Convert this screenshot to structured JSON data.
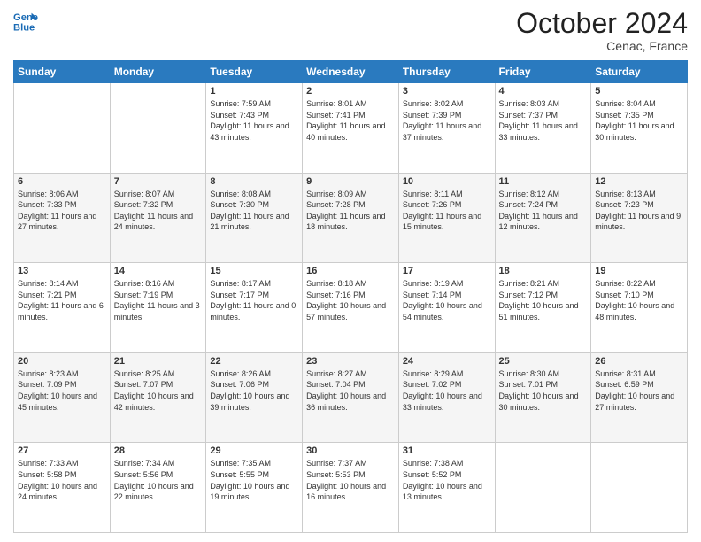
{
  "header": {
    "logo_line1": "General",
    "logo_line2": "Blue",
    "month": "October 2024",
    "location": "Cenac, France"
  },
  "days_of_week": [
    "Sunday",
    "Monday",
    "Tuesday",
    "Wednesday",
    "Thursday",
    "Friday",
    "Saturday"
  ],
  "weeks": [
    [
      {
        "day": "",
        "sunrise": "",
        "sunset": "",
        "daylight": ""
      },
      {
        "day": "",
        "sunrise": "",
        "sunset": "",
        "daylight": ""
      },
      {
        "day": "1",
        "sunrise": "Sunrise: 7:59 AM",
        "sunset": "Sunset: 7:43 PM",
        "daylight": "Daylight: 11 hours and 43 minutes."
      },
      {
        "day": "2",
        "sunrise": "Sunrise: 8:01 AM",
        "sunset": "Sunset: 7:41 PM",
        "daylight": "Daylight: 11 hours and 40 minutes."
      },
      {
        "day": "3",
        "sunrise": "Sunrise: 8:02 AM",
        "sunset": "Sunset: 7:39 PM",
        "daylight": "Daylight: 11 hours and 37 minutes."
      },
      {
        "day": "4",
        "sunrise": "Sunrise: 8:03 AM",
        "sunset": "Sunset: 7:37 PM",
        "daylight": "Daylight: 11 hours and 33 minutes."
      },
      {
        "day": "5",
        "sunrise": "Sunrise: 8:04 AM",
        "sunset": "Sunset: 7:35 PM",
        "daylight": "Daylight: 11 hours and 30 minutes."
      }
    ],
    [
      {
        "day": "6",
        "sunrise": "Sunrise: 8:06 AM",
        "sunset": "Sunset: 7:33 PM",
        "daylight": "Daylight: 11 hours and 27 minutes."
      },
      {
        "day": "7",
        "sunrise": "Sunrise: 8:07 AM",
        "sunset": "Sunset: 7:32 PM",
        "daylight": "Daylight: 11 hours and 24 minutes."
      },
      {
        "day": "8",
        "sunrise": "Sunrise: 8:08 AM",
        "sunset": "Sunset: 7:30 PM",
        "daylight": "Daylight: 11 hours and 21 minutes."
      },
      {
        "day": "9",
        "sunrise": "Sunrise: 8:09 AM",
        "sunset": "Sunset: 7:28 PM",
        "daylight": "Daylight: 11 hours and 18 minutes."
      },
      {
        "day": "10",
        "sunrise": "Sunrise: 8:11 AM",
        "sunset": "Sunset: 7:26 PM",
        "daylight": "Daylight: 11 hours and 15 minutes."
      },
      {
        "day": "11",
        "sunrise": "Sunrise: 8:12 AM",
        "sunset": "Sunset: 7:24 PM",
        "daylight": "Daylight: 11 hours and 12 minutes."
      },
      {
        "day": "12",
        "sunrise": "Sunrise: 8:13 AM",
        "sunset": "Sunset: 7:23 PM",
        "daylight": "Daylight: 11 hours and 9 minutes."
      }
    ],
    [
      {
        "day": "13",
        "sunrise": "Sunrise: 8:14 AM",
        "sunset": "Sunset: 7:21 PM",
        "daylight": "Daylight: 11 hours and 6 minutes."
      },
      {
        "day": "14",
        "sunrise": "Sunrise: 8:16 AM",
        "sunset": "Sunset: 7:19 PM",
        "daylight": "Daylight: 11 hours and 3 minutes."
      },
      {
        "day": "15",
        "sunrise": "Sunrise: 8:17 AM",
        "sunset": "Sunset: 7:17 PM",
        "daylight": "Daylight: 11 hours and 0 minutes."
      },
      {
        "day": "16",
        "sunrise": "Sunrise: 8:18 AM",
        "sunset": "Sunset: 7:16 PM",
        "daylight": "Daylight: 10 hours and 57 minutes."
      },
      {
        "day": "17",
        "sunrise": "Sunrise: 8:19 AM",
        "sunset": "Sunset: 7:14 PM",
        "daylight": "Daylight: 10 hours and 54 minutes."
      },
      {
        "day": "18",
        "sunrise": "Sunrise: 8:21 AM",
        "sunset": "Sunset: 7:12 PM",
        "daylight": "Daylight: 10 hours and 51 minutes."
      },
      {
        "day": "19",
        "sunrise": "Sunrise: 8:22 AM",
        "sunset": "Sunset: 7:10 PM",
        "daylight": "Daylight: 10 hours and 48 minutes."
      }
    ],
    [
      {
        "day": "20",
        "sunrise": "Sunrise: 8:23 AM",
        "sunset": "Sunset: 7:09 PM",
        "daylight": "Daylight: 10 hours and 45 minutes."
      },
      {
        "day": "21",
        "sunrise": "Sunrise: 8:25 AM",
        "sunset": "Sunset: 7:07 PM",
        "daylight": "Daylight: 10 hours and 42 minutes."
      },
      {
        "day": "22",
        "sunrise": "Sunrise: 8:26 AM",
        "sunset": "Sunset: 7:06 PM",
        "daylight": "Daylight: 10 hours and 39 minutes."
      },
      {
        "day": "23",
        "sunrise": "Sunrise: 8:27 AM",
        "sunset": "Sunset: 7:04 PM",
        "daylight": "Daylight: 10 hours and 36 minutes."
      },
      {
        "day": "24",
        "sunrise": "Sunrise: 8:29 AM",
        "sunset": "Sunset: 7:02 PM",
        "daylight": "Daylight: 10 hours and 33 minutes."
      },
      {
        "day": "25",
        "sunrise": "Sunrise: 8:30 AM",
        "sunset": "Sunset: 7:01 PM",
        "daylight": "Daylight: 10 hours and 30 minutes."
      },
      {
        "day": "26",
        "sunrise": "Sunrise: 8:31 AM",
        "sunset": "Sunset: 6:59 PM",
        "daylight": "Daylight: 10 hours and 27 minutes."
      }
    ],
    [
      {
        "day": "27",
        "sunrise": "Sunrise: 7:33 AM",
        "sunset": "Sunset: 5:58 PM",
        "daylight": "Daylight: 10 hours and 24 minutes."
      },
      {
        "day": "28",
        "sunrise": "Sunrise: 7:34 AM",
        "sunset": "Sunset: 5:56 PM",
        "daylight": "Daylight: 10 hours and 22 minutes."
      },
      {
        "day": "29",
        "sunrise": "Sunrise: 7:35 AM",
        "sunset": "Sunset: 5:55 PM",
        "daylight": "Daylight: 10 hours and 19 minutes."
      },
      {
        "day": "30",
        "sunrise": "Sunrise: 7:37 AM",
        "sunset": "Sunset: 5:53 PM",
        "daylight": "Daylight: 10 hours and 16 minutes."
      },
      {
        "day": "31",
        "sunrise": "Sunrise: 7:38 AM",
        "sunset": "Sunset: 5:52 PM",
        "daylight": "Daylight: 10 hours and 13 minutes."
      },
      {
        "day": "",
        "sunrise": "",
        "sunset": "",
        "daylight": ""
      },
      {
        "day": "",
        "sunrise": "",
        "sunset": "",
        "daylight": ""
      }
    ]
  ]
}
